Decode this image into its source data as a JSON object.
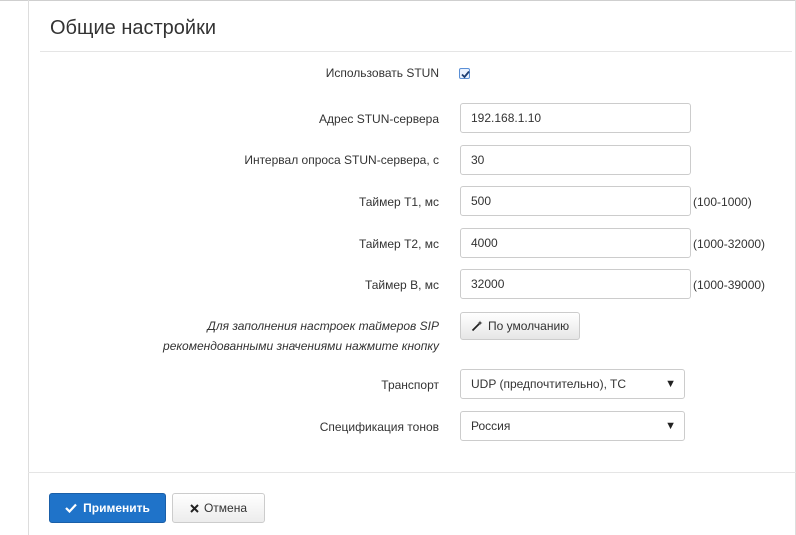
{
  "section": {
    "title": "Общие настройки"
  },
  "stun": {
    "use_label": "Использовать STUN",
    "use_checked": true,
    "server_label": "Адрес STUN-сервера",
    "server_value": "192.168.1.10",
    "interval_label": "Интервал опроса STUN-сервера, с",
    "interval_value": "30"
  },
  "timers": {
    "t1_label": "Таймер T1, мс",
    "t1_value": "500",
    "t1_hint": "(100-1000)",
    "t2_label": "Таймер T2, мс",
    "t2_value": "4000",
    "t2_hint": "(1000-32000)",
    "b_label": "Таймер B, мс",
    "b_value": "32000",
    "b_hint": "(1000-39000)",
    "note_line1": "Для заполнения настроек таймеров SIP",
    "note_line2": "рекомендованными значениями нажмите кнопку",
    "defaults_button": "По умолчанию"
  },
  "transport": {
    "label": "Транспорт",
    "value": "UDP (предпочтительно), TC"
  },
  "tones": {
    "label": "Спецификация тонов",
    "value": "Россия"
  },
  "actions": {
    "apply": "Применить",
    "cancel": "Отмена"
  },
  "colors": {
    "primary": "#1f73c9",
    "checkbox": "#5a8fd6"
  }
}
